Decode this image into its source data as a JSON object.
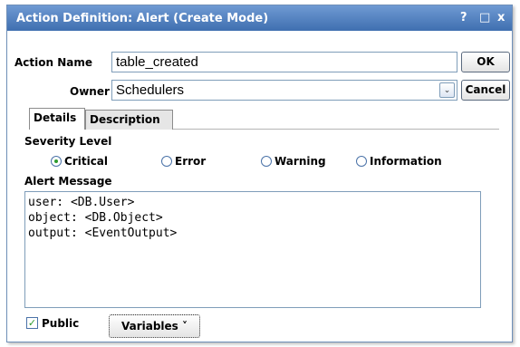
{
  "window": {
    "title": "Action Definition: Alert (Create Mode)",
    "help": "?",
    "restore": "□",
    "close": "x"
  },
  "form": {
    "action_name_label": "Action Name",
    "action_name_value": "table_created",
    "owner_label": "Owner",
    "owner_value": "Schedulers",
    "owner_dropdown_glyph": "⌄"
  },
  "buttons": {
    "ok": "OK",
    "cancel": "Cancel",
    "variables": "Variables",
    "variables_arrow": "˅"
  },
  "tabs": [
    {
      "label": "Details",
      "selected": true
    },
    {
      "label": "Description",
      "selected": false
    }
  ],
  "severity": {
    "label": "Severity Level",
    "options": [
      {
        "label": "Critical",
        "selected": true
      },
      {
        "label": "Error",
        "selected": false
      },
      {
        "label": "Warning",
        "selected": false
      },
      {
        "label": "Information",
        "selected": false
      }
    ]
  },
  "alert_message": {
    "label": "Alert Message",
    "lines": [
      "user: <DB.User>",
      "object: <DB.Object>",
      "output: <EventOutput>"
    ]
  },
  "public": {
    "label": "Public",
    "checked": true,
    "check_glyph": "✓"
  }
}
